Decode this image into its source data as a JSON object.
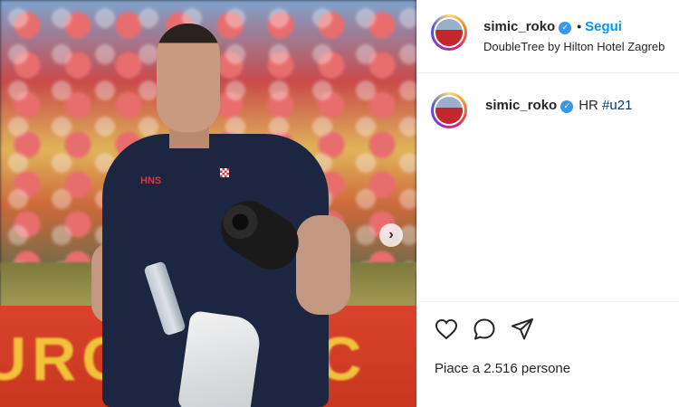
{
  "post": {
    "username": "simic_roko",
    "follow_label": "Segui",
    "location": "DoubleTree by Hilton Hotel Zagreb",
    "caption_text": "HR",
    "caption_hashtag": "#u21",
    "likes_text": "Piace a 2.516 persone"
  },
  "photo": {
    "shirt_logo": "HNS",
    "banner_text": "URC"
  },
  "icons": {
    "verified": "verified-badge-icon",
    "like": "heart-icon",
    "comment": "comment-bubble-icon",
    "share": "paper-plane-icon",
    "next": "chevron-right-icon"
  },
  "colors": {
    "accent": "#0095f6",
    "hashtag": "#00376b",
    "text": "#262626",
    "verified": "#3897f0"
  }
}
